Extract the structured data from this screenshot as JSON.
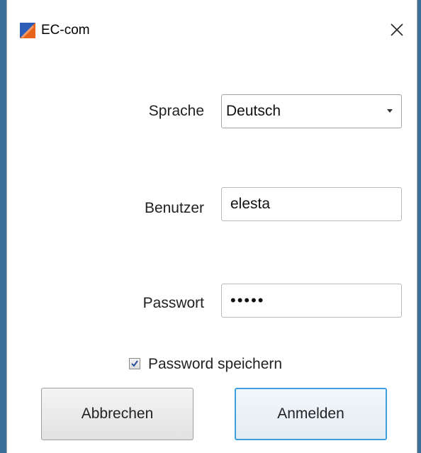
{
  "window": {
    "title": "EC-com",
    "icon": "ec-com-app-icon",
    "close_icon": "close-icon"
  },
  "form": {
    "language_label": "Sprache",
    "language_value": "Deutsch",
    "user_label": "Benutzer",
    "user_value": "elesta",
    "password_label": "Passwort",
    "password_value": "•••••",
    "remember_label": "Password speichern",
    "remember_checked": true
  },
  "buttons": {
    "cancel_label": "Abbrechen",
    "login_label": "Anmelden"
  },
  "colors": {
    "login_focus_border": "#3c9fe0",
    "icon_orange": "#e8641b",
    "icon_blue": "#2c5db7"
  }
}
